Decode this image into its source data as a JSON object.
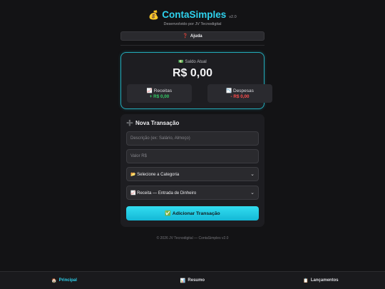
{
  "header": {
    "emoji": "💰",
    "title": "ContaSimples",
    "version": "v2.0",
    "subtitle": "Desenvolvido por JV Tecnodigital"
  },
  "help_button": {
    "icon": "❓",
    "label": "Ajuda"
  },
  "balance": {
    "icon": "💵",
    "label": "Saldo Atual",
    "value": "R$ 0,00",
    "income": {
      "icon": "📈",
      "label": "Receitas",
      "value": "+ R$ 0,00",
      "color": "#33cc66"
    },
    "expense": {
      "icon": "📉",
      "label": "Despesas",
      "value": "- R$ 0,00",
      "color": "#ff4d4d"
    }
  },
  "form": {
    "icon": "➕",
    "title": "Nova Transação",
    "description_placeholder": "Descrição (ex: Salário, Almoço)",
    "value_placeholder": "Valor R$",
    "category_selected": "📂 Selecione a Categoria",
    "type_selected": "📈 Receita — Entrada de Dinheiro",
    "submit": {
      "icon": "✅",
      "label": "Adicionar Transação"
    }
  },
  "footer": {
    "text": "© 2026 JV Tecnodigital — ContaSimples v2.0"
  },
  "nav": {
    "items": [
      {
        "icon": "🏠",
        "label": "Principal",
        "active": true
      },
      {
        "icon": "📊",
        "label": "Resumo",
        "active": false
      },
      {
        "icon": "📋",
        "label": "Lançamentos",
        "active": false
      }
    ]
  },
  "colors": {
    "accent": "#2ed2ee",
    "background": "#131315",
    "card": "#1d1d21"
  }
}
